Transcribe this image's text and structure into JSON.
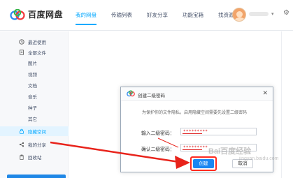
{
  "app": {
    "title": "百度网盘",
    "brand_color": "#09aaff"
  },
  "nav": {
    "items": [
      {
        "label": "我的网盘",
        "active": true
      },
      {
        "label": "传输列表",
        "active": false
      },
      {
        "label": "好友分享",
        "active": false
      },
      {
        "label": "功能宝箱",
        "active": false
      },
      {
        "label": "找资源",
        "active": false
      }
    ]
  },
  "user": {
    "dropdown_icon": "chevron-down-icon",
    "settings_icon": "gear-icon"
  },
  "sidebar": {
    "items": [
      {
        "label": "最近使用",
        "icon": "clock-icon"
      },
      {
        "label": "全部文件",
        "icon": "document-icon"
      },
      {
        "label": "图片"
      },
      {
        "label": "视频"
      },
      {
        "label": "文档"
      },
      {
        "label": "音乐"
      },
      {
        "label": "种子"
      },
      {
        "label": "其它"
      },
      {
        "label": "隐藏空间",
        "icon": "lock-icon",
        "active": true
      },
      {
        "label": "我的分享",
        "icon": "share-icon"
      },
      {
        "label": "回收站",
        "icon": "trash-icon"
      }
    ]
  },
  "dialog": {
    "title": "创建二级密码",
    "tip": "为保护你的文件隐私，启用隐藏空间需要先设置二级密码",
    "field1_label": "输入二级密码：",
    "field1_value": "*********",
    "field2_label": "确认二级密码：",
    "field2_value": "*********",
    "create_label": "创建",
    "cancel_label": "取消",
    "close_icon": "close-icon",
    "highlight_color": "#ff2a1f"
  },
  "watermark": {
    "text": "Bai百度经验",
    "sub": "jingyan.baidu.com"
  }
}
